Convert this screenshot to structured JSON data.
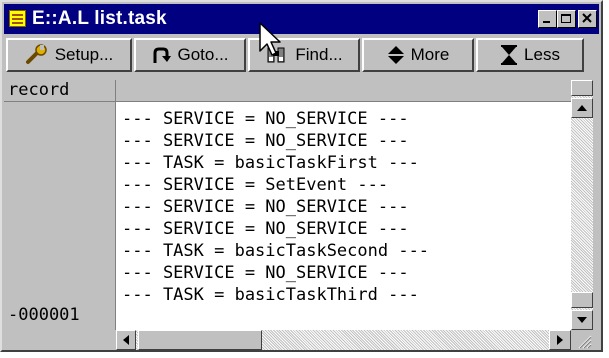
{
  "window": {
    "title": "E::A.L list.task",
    "icon": "window-app-icon",
    "caption_buttons": [
      "minimize",
      "maximize",
      "close"
    ]
  },
  "toolbar": {
    "buttons": [
      {
        "label": "Setup...",
        "icon": "wrench-icon"
      },
      {
        "label": "Goto...",
        "icon": "goto-arrow-icon"
      },
      {
        "label": "Find...",
        "icon": "find-binoculars-icon"
      },
      {
        "label": "More",
        "icon": "up-down-arrows-icon"
      },
      {
        "label": "Less",
        "icon": "hourglass-icon"
      }
    ]
  },
  "listing": {
    "column_header": "record",
    "record_number": "-000001",
    "lines": [
      "--- SERVICE = NO_SERVICE ---",
      "--- SERVICE = NO_SERVICE ---",
      "--- TASK = basicTaskFirst ---",
      "--- SERVICE = SetEvent ---",
      "--- SERVICE = NO_SERVICE ---",
      "--- SERVICE = NO_SERVICE ---",
      "--- TASK = basicTaskSecond ---",
      "--- SERVICE = NO_SERVICE ---",
      "--- TASK = basicTaskThird ---"
    ]
  },
  "colors": {
    "titlebar": "#000080",
    "face": "#c0c0c0",
    "text_area": "#ffffff"
  }
}
